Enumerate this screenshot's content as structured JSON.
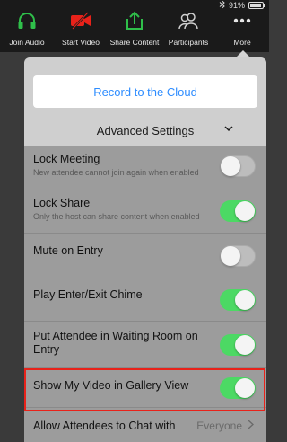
{
  "status": {
    "battery": "91%"
  },
  "toolbar": {
    "items": [
      {
        "label": "Join Audio",
        "icon": "headphones-icon"
      },
      {
        "label": "Start Video",
        "icon": "video-off-icon"
      },
      {
        "label": "Share Content",
        "icon": "share-icon"
      },
      {
        "label": "Participants",
        "icon": "participants-icon"
      },
      {
        "label": "More",
        "icon": "more-icon"
      }
    ]
  },
  "panel": {
    "record_label": "Record to the Cloud",
    "advanced_label": "Advanced Settings",
    "settings": [
      {
        "title": "Lock Meeting",
        "subtitle": "New attendee cannot join again when enabled",
        "on": false
      },
      {
        "title": "Lock Share",
        "subtitle": "Only the host can share content when enabled",
        "on": true
      },
      {
        "title": "Mute on Entry",
        "on": false
      },
      {
        "title": "Play Enter/Exit Chime",
        "on": true
      },
      {
        "title": "Put Attendee in Waiting Room on Entry",
        "on": true,
        "highlighted": true
      },
      {
        "title": "Show My Video in Gallery View",
        "on": true
      },
      {
        "title": "Allow Attendees to Chat with",
        "value": "Everyone"
      }
    ]
  },
  "colors": {
    "accent_blue": "#2d8cff",
    "toggle_on": "#4cd964",
    "highlight_red": "#e8221a",
    "video_off_red": "#e8221a",
    "share_green": "#2fbf4a"
  }
}
